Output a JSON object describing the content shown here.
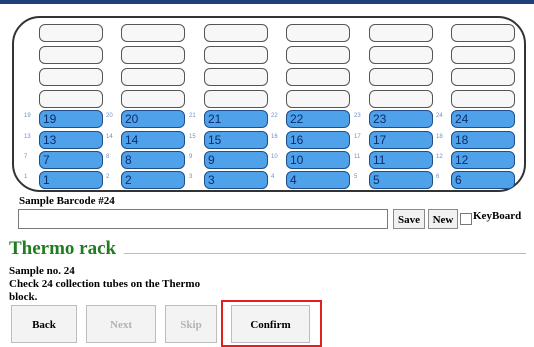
{
  "rack": {
    "empty_rows": 4,
    "filled_rows": [
      {
        "tubes": [
          {
            "tiny": "19",
            "num": "19"
          },
          {
            "tiny": "20",
            "num": "20"
          },
          {
            "tiny": "21",
            "num": "21"
          },
          {
            "tiny": "22",
            "num": "22"
          },
          {
            "tiny": "23",
            "num": "23"
          },
          {
            "tiny": "24",
            "num": "24"
          }
        ]
      },
      {
        "tubes": [
          {
            "tiny": "13",
            "num": "13"
          },
          {
            "tiny": "14",
            "num": "14"
          },
          {
            "tiny": "15",
            "num": "15"
          },
          {
            "tiny": "16",
            "num": "16"
          },
          {
            "tiny": "17",
            "num": "17"
          },
          {
            "tiny": "18",
            "num": "18"
          }
        ]
      },
      {
        "tubes": [
          {
            "tiny": "7",
            "num": "7"
          },
          {
            "tiny": "8",
            "num": "8"
          },
          {
            "tiny": "9",
            "num": "9"
          },
          {
            "tiny": "10",
            "num": "10"
          },
          {
            "tiny": "11",
            "num": "11"
          },
          {
            "tiny": "12",
            "num": "12"
          }
        ]
      },
      {
        "tubes": [
          {
            "tiny": "1",
            "num": "1"
          },
          {
            "tiny": "2",
            "num": "2"
          },
          {
            "tiny": "3",
            "num": "3"
          },
          {
            "tiny": "4",
            "num": "4"
          },
          {
            "tiny": "5",
            "num": "5"
          },
          {
            "tiny": "6",
            "num": "6"
          }
        ]
      }
    ],
    "colors": {
      "filled": "#4fa1ea",
      "empty": "#f7f7f7"
    }
  },
  "barcode": {
    "label": "Sample Barcode #24",
    "value": ""
  },
  "buttons": {
    "save": "Save",
    "new": "New",
    "keyboard": "KeyBoard"
  },
  "title": "Thermo rack",
  "info": {
    "sample": "Sample no. 24",
    "instruction_1": "Check 24 collection tubes on the Thermo",
    "instruction_2": "block."
  },
  "nav": {
    "back": "Back",
    "next": "Next",
    "skip": "Skip",
    "confirm": "Confirm"
  },
  "highlight_color": "#e01f1f"
}
